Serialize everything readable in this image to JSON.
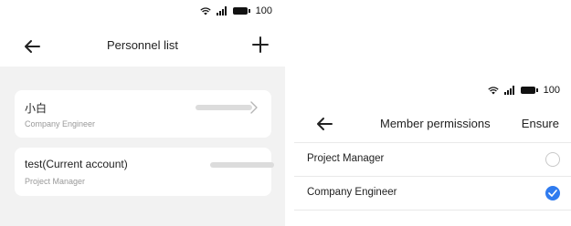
{
  "left_screen": {
    "status_bar": {
      "battery": "100",
      "icons": [
        "wifi-icon",
        "signal-icon",
        "battery-icon"
      ]
    },
    "header": {
      "title": "Personnel list",
      "back_icon": "arrow-left-icon",
      "add_icon": "plus-icon"
    },
    "members": [
      {
        "name": "小白",
        "role": "Company Engineer",
        "has_chevron": true
      },
      {
        "name": "test(Current account)",
        "role": "Project Manager",
        "has_chevron": false
      }
    ]
  },
  "right_screen": {
    "status_bar": {
      "battery": "100"
    },
    "header": {
      "title": "Member permissions",
      "action": "Ensure",
      "back_icon": "arrow-left-icon"
    },
    "options": [
      {
        "label": "Project Manager",
        "selected": false
      },
      {
        "label": "Company Engineer",
        "selected": true
      }
    ]
  },
  "colors": {
    "accent": "#2f7bef",
    "background_gray": "#f2f2f2",
    "secondary_text": "#999999"
  }
}
